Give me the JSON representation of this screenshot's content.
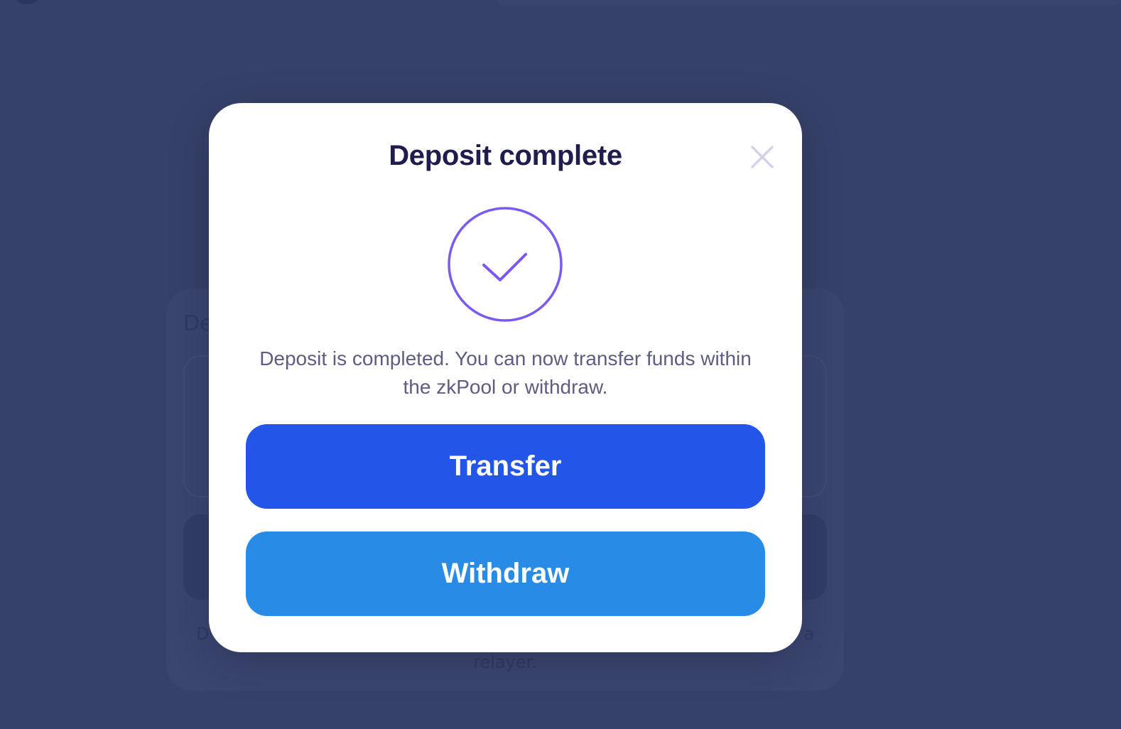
{
  "background": {
    "card_title_fragment": "De",
    "note_left_fragment": "D",
    "note_right_fragment": "a",
    "note_second_line": "relayer."
  },
  "modal": {
    "title": "Deposit complete",
    "close_icon": "close-icon",
    "status_icon": "check-circle-icon",
    "message_line1": "Deposit is completed. You can now transfer funds within",
    "message_line2": "the zkPool or withdraw.",
    "transfer_label": "Transfer",
    "withdraw_label": "Withdraw"
  },
  "colors": {
    "backdrop": "#36416a",
    "title": "#1f1d4d",
    "message": "#5e5c80",
    "check_accent": "#7a5af0",
    "close_icon": "#d4d2e8",
    "transfer_button": "#2356e8",
    "withdraw_button": "#288ce6"
  }
}
